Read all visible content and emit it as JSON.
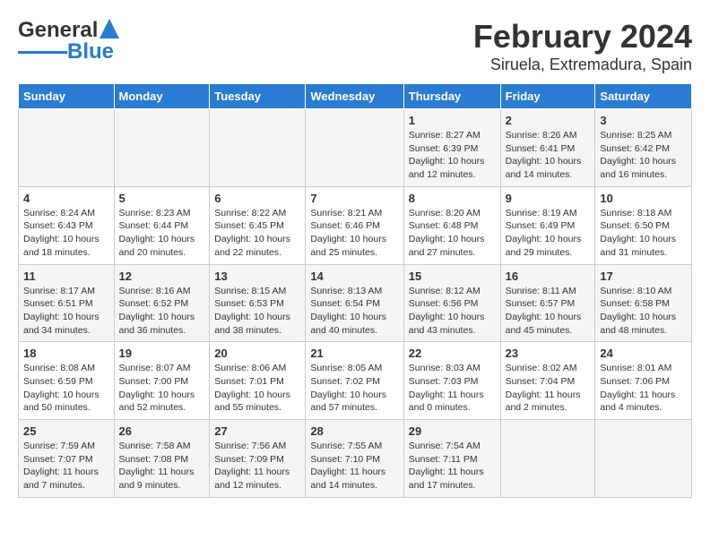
{
  "logo": {
    "line1": "General",
    "line2": "Blue"
  },
  "title": "February 2024",
  "subtitle": "Siruela, Extremadura, Spain",
  "headers": [
    "Sunday",
    "Monday",
    "Tuesday",
    "Wednesday",
    "Thursday",
    "Friday",
    "Saturday"
  ],
  "weeks": [
    [
      {
        "day": "",
        "info": ""
      },
      {
        "day": "",
        "info": ""
      },
      {
        "day": "",
        "info": ""
      },
      {
        "day": "",
        "info": ""
      },
      {
        "day": "1",
        "info": "Sunrise: 8:27 AM\nSunset: 6:39 PM\nDaylight: 10 hours\nand 12 minutes."
      },
      {
        "day": "2",
        "info": "Sunrise: 8:26 AM\nSunset: 6:41 PM\nDaylight: 10 hours\nand 14 minutes."
      },
      {
        "day": "3",
        "info": "Sunrise: 8:25 AM\nSunset: 6:42 PM\nDaylight: 10 hours\nand 16 minutes."
      }
    ],
    [
      {
        "day": "4",
        "info": "Sunrise: 8:24 AM\nSunset: 6:43 PM\nDaylight: 10 hours\nand 18 minutes."
      },
      {
        "day": "5",
        "info": "Sunrise: 8:23 AM\nSunset: 6:44 PM\nDaylight: 10 hours\nand 20 minutes."
      },
      {
        "day": "6",
        "info": "Sunrise: 8:22 AM\nSunset: 6:45 PM\nDaylight: 10 hours\nand 22 minutes."
      },
      {
        "day": "7",
        "info": "Sunrise: 8:21 AM\nSunset: 6:46 PM\nDaylight: 10 hours\nand 25 minutes."
      },
      {
        "day": "8",
        "info": "Sunrise: 8:20 AM\nSunset: 6:48 PM\nDaylight: 10 hours\nand 27 minutes."
      },
      {
        "day": "9",
        "info": "Sunrise: 8:19 AM\nSunset: 6:49 PM\nDaylight: 10 hours\nand 29 minutes."
      },
      {
        "day": "10",
        "info": "Sunrise: 8:18 AM\nSunset: 6:50 PM\nDaylight: 10 hours\nand 31 minutes."
      }
    ],
    [
      {
        "day": "11",
        "info": "Sunrise: 8:17 AM\nSunset: 6:51 PM\nDaylight: 10 hours\nand 34 minutes."
      },
      {
        "day": "12",
        "info": "Sunrise: 8:16 AM\nSunset: 6:52 PM\nDaylight: 10 hours\nand 36 minutes."
      },
      {
        "day": "13",
        "info": "Sunrise: 8:15 AM\nSunset: 6:53 PM\nDaylight: 10 hours\nand 38 minutes."
      },
      {
        "day": "14",
        "info": "Sunrise: 8:13 AM\nSunset: 6:54 PM\nDaylight: 10 hours\nand 40 minutes."
      },
      {
        "day": "15",
        "info": "Sunrise: 8:12 AM\nSunset: 6:56 PM\nDaylight: 10 hours\nand 43 minutes."
      },
      {
        "day": "16",
        "info": "Sunrise: 8:11 AM\nSunset: 6:57 PM\nDaylight: 10 hours\nand 45 minutes."
      },
      {
        "day": "17",
        "info": "Sunrise: 8:10 AM\nSunset: 6:58 PM\nDaylight: 10 hours\nand 48 minutes."
      }
    ],
    [
      {
        "day": "18",
        "info": "Sunrise: 8:08 AM\nSunset: 6:59 PM\nDaylight: 10 hours\nand 50 minutes."
      },
      {
        "day": "19",
        "info": "Sunrise: 8:07 AM\nSunset: 7:00 PM\nDaylight: 10 hours\nand 52 minutes."
      },
      {
        "day": "20",
        "info": "Sunrise: 8:06 AM\nSunset: 7:01 PM\nDaylight: 10 hours\nand 55 minutes."
      },
      {
        "day": "21",
        "info": "Sunrise: 8:05 AM\nSunset: 7:02 PM\nDaylight: 10 hours\nand 57 minutes."
      },
      {
        "day": "22",
        "info": "Sunrise: 8:03 AM\nSunset: 7:03 PM\nDaylight: 11 hours\nand 0 minutes."
      },
      {
        "day": "23",
        "info": "Sunrise: 8:02 AM\nSunset: 7:04 PM\nDaylight: 11 hours\nand 2 minutes."
      },
      {
        "day": "24",
        "info": "Sunrise: 8:01 AM\nSunset: 7:06 PM\nDaylight: 11 hours\nand 4 minutes."
      }
    ],
    [
      {
        "day": "25",
        "info": "Sunrise: 7:59 AM\nSunset: 7:07 PM\nDaylight: 11 hours\nand 7 minutes."
      },
      {
        "day": "26",
        "info": "Sunrise: 7:58 AM\nSunset: 7:08 PM\nDaylight: 11 hours\nand 9 minutes."
      },
      {
        "day": "27",
        "info": "Sunrise: 7:56 AM\nSunset: 7:09 PM\nDaylight: 11 hours\nand 12 minutes."
      },
      {
        "day": "28",
        "info": "Sunrise: 7:55 AM\nSunset: 7:10 PM\nDaylight: 11 hours\nand 14 minutes."
      },
      {
        "day": "29",
        "info": "Sunrise: 7:54 AM\nSunset: 7:11 PM\nDaylight: 11 hours\nand 17 minutes."
      },
      {
        "day": "",
        "info": ""
      },
      {
        "day": "",
        "info": ""
      }
    ]
  ]
}
